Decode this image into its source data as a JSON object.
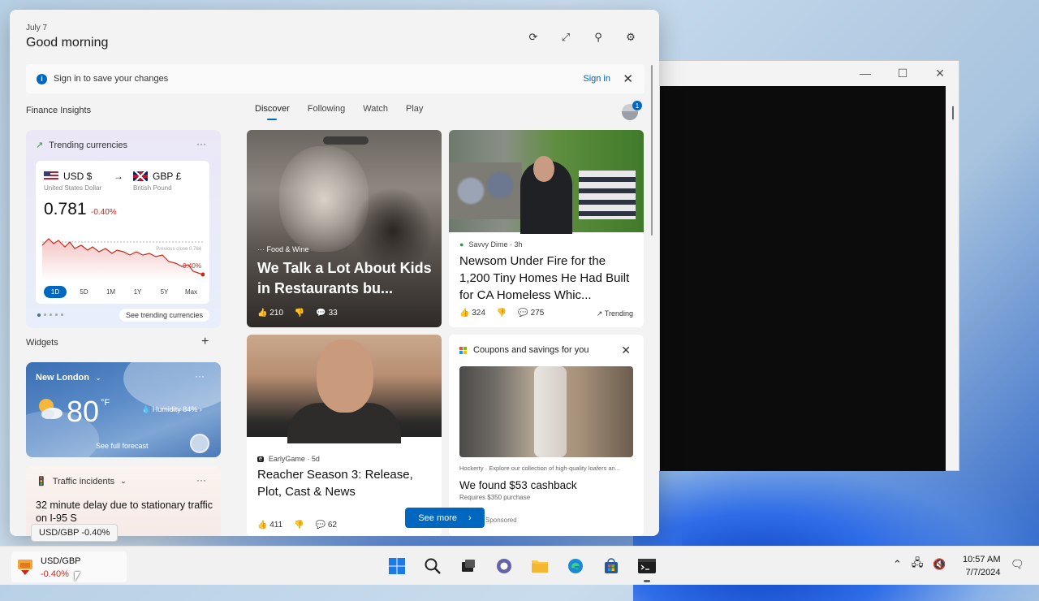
{
  "panel": {
    "date": "July 7",
    "greeting": "Good morning"
  },
  "signin_bar": {
    "message": "Sign in to save your changes",
    "signin_link": "Sign in"
  },
  "sections": {
    "finance": "Finance Insights",
    "widgets": "Widgets"
  },
  "finance_card": {
    "title": "Trending currencies",
    "from_code": "USD $",
    "from_name": "United States Dollar",
    "to_code": "GBP £",
    "to_name": "British Pound",
    "rate": "0.781",
    "change": "-0.40%",
    "prev_close_label": "Previous close 0.784",
    "chart_change": "-0.40%",
    "ranges": [
      "1D",
      "5D",
      "1M",
      "1Y",
      "5Y",
      "Max"
    ],
    "active_range": "1D",
    "see_link": "See trending currencies"
  },
  "weather": {
    "location": "New London",
    "temperature": "80",
    "unit": "°F",
    "humidity": "Humidity 84%",
    "forecast_link": "See full forecast"
  },
  "traffic": {
    "title": "Traffic incidents",
    "description": "32 minute delay due to stationary traffic on I-95 S"
  },
  "feed_tabs": [
    "Discover",
    "Following",
    "Watch",
    "Play"
  ],
  "active_tab": "Discover",
  "profile_badge": "1",
  "cards": [
    {
      "source": "Food & Wine",
      "title": "We Talk a Lot About Kids in Restaurants bu...",
      "likes": "210",
      "comments": "33"
    },
    {
      "source": "Savvy Dime · 3h",
      "title": "Newsom Under Fire for the 1,200 Tiny Homes He Had Built for CA Homeless Whic...",
      "likes": "324",
      "comments": "275",
      "tag": "Trending"
    },
    {
      "source": "EarlyGame · 5d",
      "title": "Reacher Season 3: Release, Plot, Cast & News",
      "likes": "411",
      "comments": "62"
    }
  ],
  "ad_card": {
    "header": "Coupons and savings for you",
    "ad_text": "Hockerty · Explore our collection of high-quality loafers an...",
    "title": "We found $53 cashback",
    "requirement": "Requires $350 purchase",
    "sponsored": "Sponsored"
  },
  "see_more": "See more",
  "tooltip": "USD/GBP -0.40%",
  "taskbar": {
    "widget_label": "USD/GBP",
    "widget_change": "-0.40%",
    "time": "10:57 AM",
    "date": "7/7/2024"
  },
  "colors": {
    "accent": "#0067c0",
    "negative": "#c42b1c"
  }
}
